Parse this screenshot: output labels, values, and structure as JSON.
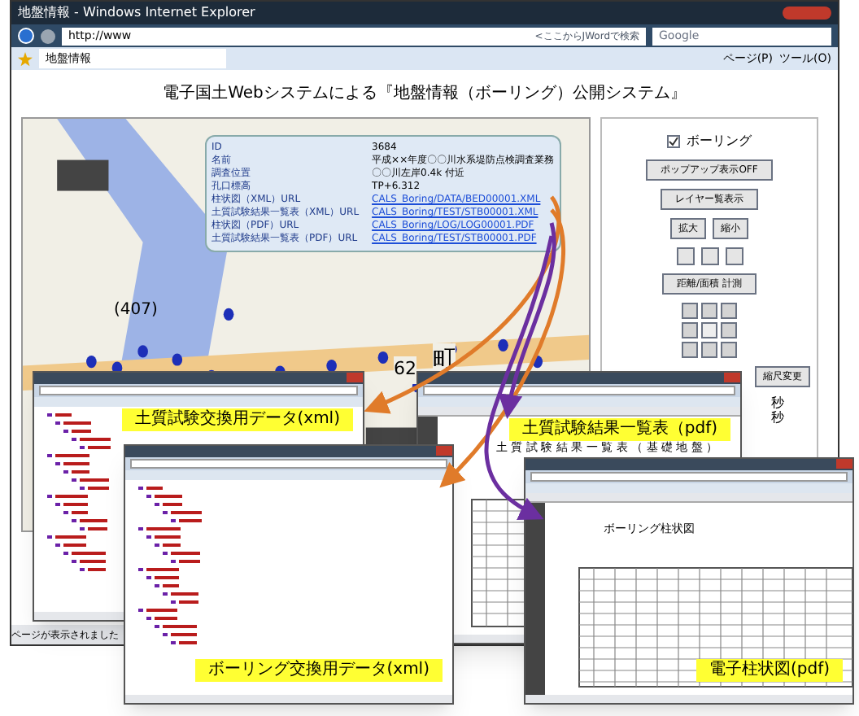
{
  "window": {
    "title": "地盤情報 - Windows Internet Explorer"
  },
  "toolbar": {
    "address": "http://www",
    "jword_hint": "<ここからJWordで検索",
    "search_placeholder": "Google"
  },
  "tabs": [
    {
      "label": "地盤情報",
      "selected": true
    }
  ],
  "commands": [
    "ページ(P)",
    "ツール(O)"
  ],
  "page": {
    "heading": "電子国土Webシステムによる『地盤情報（ボーリング）公開システム』",
    "map": {
      "road_label": "(407)",
      "town_label": "町",
      "number_label": "62",
      "popup": [
        {
          "label": "ID",
          "value": "3684",
          "link": false
        },
        {
          "label": "名前",
          "value": "平成××年度〇〇川水系堤防点検調査業務",
          "link": false
        },
        {
          "label": "調査位置",
          "value": "〇〇川左岸0.4k 付近",
          "link": false
        },
        {
          "label": "孔口標高",
          "value": "TP+6.312",
          "link": false
        },
        {
          "label": "柱状図（XML）URL",
          "value": "CALS_Boring/DATA/BED00001.XML",
          "link": true
        },
        {
          "label": "土質試験結果一覧表（XML）URL",
          "value": "CALS_Boring/TEST/STB00001.XML",
          "link": true
        },
        {
          "label": "柱状図（PDF）URL",
          "value": "CALS_Boring/LOG/LOG00001.PDF",
          "link": true
        },
        {
          "label": "土質試験結果一覧表（PDF）URL",
          "value": "CALS_Boring/TEST/STB00001.PDF",
          "link": true
        }
      ]
    },
    "panel": {
      "layer": {
        "label": "ボーリング",
        "checked": true
      },
      "popup_button": "ポップアップ表示OFF",
      "layer_button": "レイヤー覧表示",
      "zoom_buttons": [
        "拡大",
        "縮小"
      ],
      "measure_button": "距離/面積 計測",
      "scale_button": "縮尺変更",
      "units": [
        "秒",
        "秒"
      ]
    }
  },
  "status_bar": "ページが表示されました",
  "overlays": [
    {
      "kind": "xml",
      "caption": "土質試験交換用データ(xml)"
    },
    {
      "kind": "pdf",
      "caption": "土質試験結果一覧表（pdf)",
      "doc_title": "土 質 試 験 結 果 一 覧 表 （ 基 礎 地 盤 ）"
    },
    {
      "kind": "xml",
      "caption": "ボーリング交換用データ(xml)"
    },
    {
      "kind": "pdf",
      "caption": "電子柱状図(pdf)",
      "doc_title": "ボーリング柱状図"
    }
  ]
}
